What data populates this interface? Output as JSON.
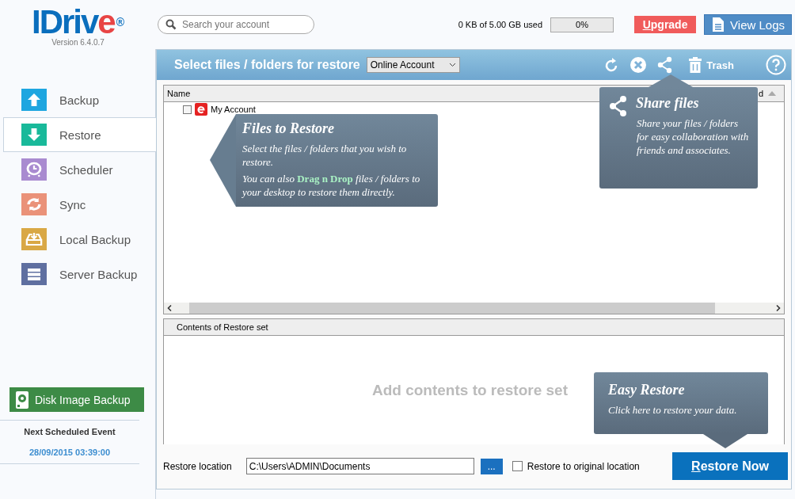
{
  "logo": {
    "brand": "IDriv",
    "accent": "e",
    "registered": "®",
    "version": "Version  6.4.0.7"
  },
  "search": {
    "placeholder": "Search your account"
  },
  "usage": {
    "text": "0 KB of 5.00 GB used",
    "reading": "0%"
  },
  "upgrade_button": "Upgrade",
  "view_logs_button": "View Logs",
  "sidebar": {
    "items": [
      {
        "label": "Backup",
        "color": "#1ea6e0",
        "selected": false
      },
      {
        "label": "Restore",
        "color": "#19b99a",
        "selected": true
      },
      {
        "label": "Scheduler",
        "color": "#a98bd0",
        "selected": false
      },
      {
        "label": "Sync",
        "color": "#ea9279",
        "selected": false
      },
      {
        "label": "Local Backup",
        "color": "#d9a845",
        "selected": false
      },
      {
        "label": "Server Backup",
        "color": "#5f6fa0",
        "selected": false
      }
    ]
  },
  "disk_image_button": "Disk Image Backup",
  "next_event": {
    "label": "Next Scheduled Event",
    "time": "28/09/2015 03:39:00"
  },
  "panel": {
    "title": "Select files / folders for restore",
    "account_dropdown": "Online Account",
    "trash_label": "Trash"
  },
  "tree": {
    "columns": [
      "Name",
      "d"
    ],
    "rows": [
      {
        "label": "My Account",
        "checked": false
      }
    ]
  },
  "restore_set": {
    "header": "Contents of Restore set",
    "empty_message": "Add contents to restore set"
  },
  "bottom": {
    "location_label": "Restore location",
    "location_value": "C:\\Users\\ADMIN\\Documents",
    "browse_button": "...",
    "original_location": {
      "label": "Restore to original location",
      "checked": false
    },
    "restore_button": "Restore Now"
  },
  "tooltips": [
    {
      "kind": "left",
      "title": "Files to Restore",
      "paragraphs": [
        "Select the files / folders that you wish to restore.",
        "You can also **Drag n Drop** files / folders to your desktop to restore them directly."
      ]
    },
    {
      "kind": "top",
      "title": "Share files",
      "paragraphs": [
        "Share your files / folders for easy collaboration with friends and associates."
      ]
    },
    {
      "kind": "bottom",
      "title": "Easy Restore",
      "paragraphs": [
        "Click here to restore your data."
      ]
    }
  ]
}
